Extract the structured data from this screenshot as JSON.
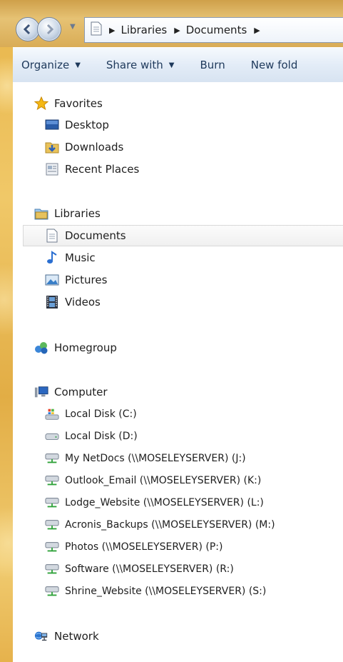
{
  "address": {
    "crumbs": [
      "Libraries",
      "Documents"
    ]
  },
  "toolbar": {
    "organize": "Organize",
    "share_with": "Share with",
    "burn": "Burn",
    "new_folder": "New fold"
  },
  "nav": {
    "favorites": {
      "label": "Favorites",
      "items": [
        "Desktop",
        "Downloads",
        "Recent Places"
      ]
    },
    "libraries": {
      "label": "Libraries",
      "items": [
        "Documents",
        "Music",
        "Pictures",
        "Videos"
      ],
      "selected": "Documents"
    },
    "homegroup": {
      "label": "Homegroup"
    },
    "computer": {
      "label": "Computer",
      "items": [
        "Local Disk (C:)",
        "Local Disk (D:)",
        "My NetDocs (\\\\MOSELEYSERVER) (J:)",
        "Outlook_Email (\\\\MOSELEYSERVER) (K:)",
        "Lodge_Website (\\\\MOSELEYSERVER) (L:)",
        "Acronis_Backups (\\\\MOSELEYSERVER) (M:)",
        "Photos (\\\\MOSELEYSERVER) (P:)",
        "Software (\\\\MOSELEYSERVER) (R:)",
        "Shrine_Website (\\\\MOSELEYSERVER) (S:)"
      ]
    },
    "network": {
      "label": "Network"
    }
  },
  "icons": {
    "back": "back-arrow-icon",
    "forward": "forward-arrow-icon",
    "favorites": "star-icon",
    "desktop": "desktop-icon",
    "downloads": "downloads-folder-icon",
    "recent": "recent-places-icon",
    "libraries": "libraries-icon",
    "documents": "document-icon",
    "music": "music-note-icon",
    "pictures": "pictures-icon",
    "videos": "video-film-icon",
    "homegroup": "homegroup-icon",
    "computer": "computer-icon",
    "local_disk_c": "system-drive-icon",
    "local_disk": "drive-icon",
    "network_drive": "network-drive-icon",
    "network": "network-icon"
  },
  "colors": {
    "toolbar_text": "#1e395b",
    "frame": "#e8b54a"
  }
}
